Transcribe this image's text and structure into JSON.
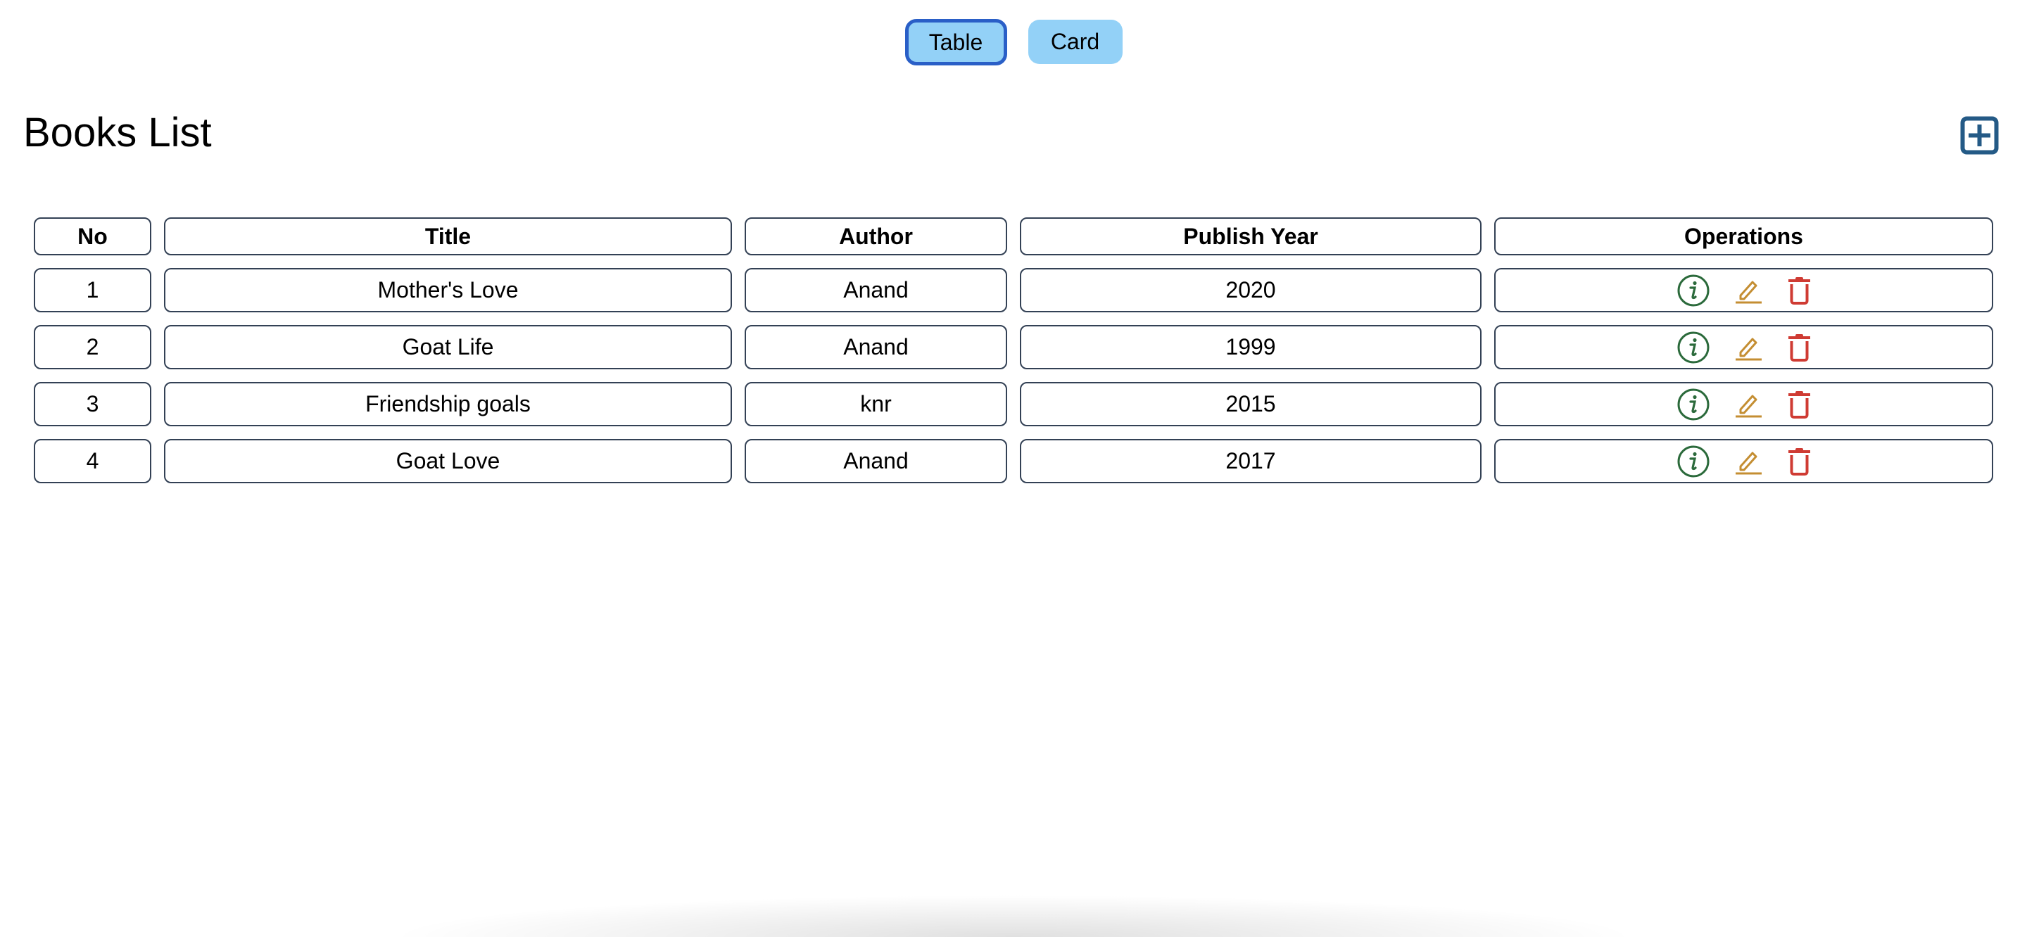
{
  "view_toggle": {
    "table_label": "Table",
    "card_label": "Card",
    "active": "Table"
  },
  "page_title": "Books List",
  "icons": {
    "add": "plus-square-icon",
    "info": "info-circle-icon",
    "edit": "pencil-icon",
    "delete": "trash-icon"
  },
  "colors": {
    "toggle_bg": "#93d1f7",
    "active_border": "#2a5fc7",
    "add": "#245a86",
    "info": "#2b6a3b",
    "edit": "#c48e32",
    "delete": "#cf3b33",
    "cell_border": "#334155"
  },
  "table": {
    "headers": [
      "No",
      "Title",
      "Author",
      "Publish Year",
      "Operations"
    ],
    "rows": [
      {
        "no": "1",
        "title": "Mother's Love",
        "author": "Anand",
        "year": "2020"
      },
      {
        "no": "2",
        "title": "Goat Life",
        "author": "Anand",
        "year": "1999"
      },
      {
        "no": "3",
        "title": "Friendship goals",
        "author": "knr",
        "year": "2015"
      },
      {
        "no": "4",
        "title": "Goat Love",
        "author": "Anand",
        "year": "2017"
      }
    ]
  }
}
